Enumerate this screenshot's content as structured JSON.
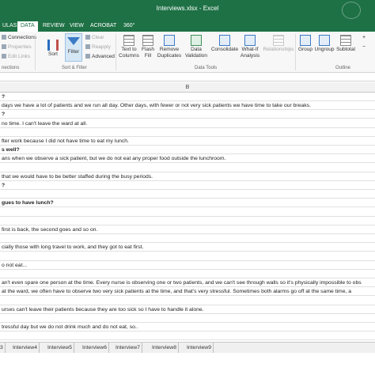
{
  "window": {
    "title": "Interviews.xlsx - Excel"
  },
  "tabs": [
    {
      "label": "ULAS",
      "active": false
    },
    {
      "label": "DATA",
      "active": true
    },
    {
      "label": "REVIEW",
      "active": false
    },
    {
      "label": "VIEW",
      "active": false
    },
    {
      "label": "ACROBAT",
      "active": false
    },
    {
      "label": "360°",
      "active": false
    }
  ],
  "ribbon": {
    "connections": "Connections",
    "properties": "Properties",
    "edit_links": "Edit Links",
    "connections_group": "nections",
    "sort": "Sort",
    "filter": "Filter",
    "clear": "Clear",
    "reapply": "Reapply",
    "advanced": "Advanced",
    "sort_filter_group": "Sort & Filter",
    "text_to_columns_1": "Text to",
    "text_to_columns_2": "Columns",
    "flash_fill_1": "Flash",
    "flash_fill_2": "Fill",
    "remove_duplicates_1": "Remove",
    "remove_duplicates_2": "Duplicates",
    "data_validation_1": "Data",
    "data_validation_2": "Validation",
    "consolidate": "Consolidate",
    "what_if_1": "What-If",
    "what_if_2": "Analysis",
    "relationships": "Relationships",
    "data_tools_group": "Data Tools",
    "group": "Group",
    "ungroup": "Ungroup",
    "subtotal": "Subtotal",
    "outline_group": "Outline"
  },
  "sheet": {
    "column_header": "B",
    "rows": [
      {
        "text": "?",
        "bold": true
      },
      {
        "text": "days we have a lot of patients and we run all day. Other days, with fewer or not very sick patients we have time to take our breaks.",
        "bold": false
      },
      {
        "text": "?",
        "bold": true
      },
      {
        "text": "no time. I can't leave the ward at all.",
        "bold": false
      },
      {
        "text": "",
        "bold": false
      },
      {
        "text": "fter work because I did not have time to eat my lunch.",
        "bold": false
      },
      {
        "text": "s well?",
        "bold": true
      },
      {
        "text": "ans when we observe a sick patient, but we do not eat any proper food outside the lunchroom.",
        "bold": false
      },
      {
        "text": "",
        "bold": false
      },
      {
        "text": "that we would have to be better staffed during the busy periods.",
        "bold": false
      },
      {
        "text": "?",
        "bold": true
      },
      {
        "text": "",
        "bold": false
      },
      {
        "text": "gues to have lunch?",
        "bold": true
      },
      {
        "text": "",
        "bold": false
      },
      {
        "text": "",
        "bold": false
      },
      {
        "text": "first is back, the second goes and so on.",
        "bold": false
      },
      {
        "text": "",
        "bold": false
      },
      {
        "text": "cially those with long travel to work, and they got to eat first.",
        "bold": false
      },
      {
        "text": "",
        "bold": false
      },
      {
        "text": "o not eat...",
        "bold": false
      },
      {
        "text": "",
        "bold": false
      },
      {
        "text": "an't even spare one person at the time. Every nurse is observing one or two patients, and we can't see through walls so it's physically impossible to obs",
        "bold": false
      },
      {
        "text": "at the ward, we often have to observe two very sick patients at the time, and that's very stressful. Sometimes both alarms go off at the same time, a",
        "bold": false
      },
      {
        "text": "",
        "bold": false
      },
      {
        "text": "urses can't leave their patients because they are too sick so I have to handle it alone.",
        "bold": false
      },
      {
        "text": "",
        "bold": false
      },
      {
        "text": "tressful day but we do not drink much and do not eat, so..",
        "bold": false
      },
      {
        "text": "",
        "bold": false
      },
      {
        "text": "",
        "bold": false
      }
    ]
  },
  "sheet_tabs": [
    "3",
    "Interview4",
    "Interview5",
    "Interview6",
    "Interview7",
    "Interview8",
    "Interview9"
  ]
}
